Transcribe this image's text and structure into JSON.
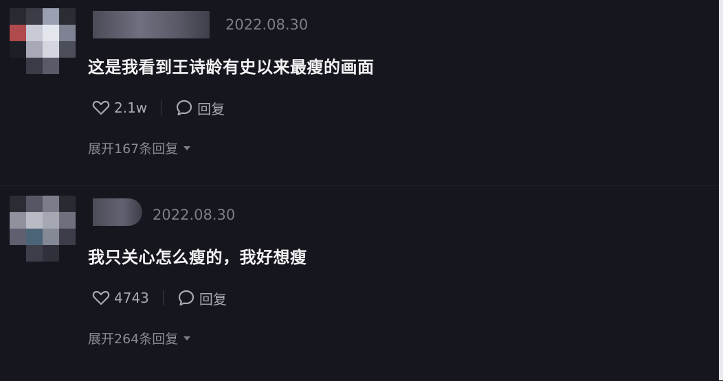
{
  "comments": [
    {
      "date": "2022.08.30",
      "text": "这是我看到王诗龄有史以来最瘦的画面",
      "likes": "2.1w",
      "reply_label": "回复",
      "expand_label": "展开167条回复"
    },
    {
      "date": "2022.08.30",
      "text": "我只关心怎么瘦的，我好想瘦",
      "likes": "4743",
      "reply_label": "回复",
      "expand_label": "展开264条回复"
    }
  ],
  "icons": {
    "like": "heart-icon",
    "reply": "speech-bubble-icon",
    "expand": "caret-down-icon"
  },
  "colors": {
    "background": "#16161e",
    "text": "#f2f2f4",
    "muted": "#7d7e86"
  }
}
